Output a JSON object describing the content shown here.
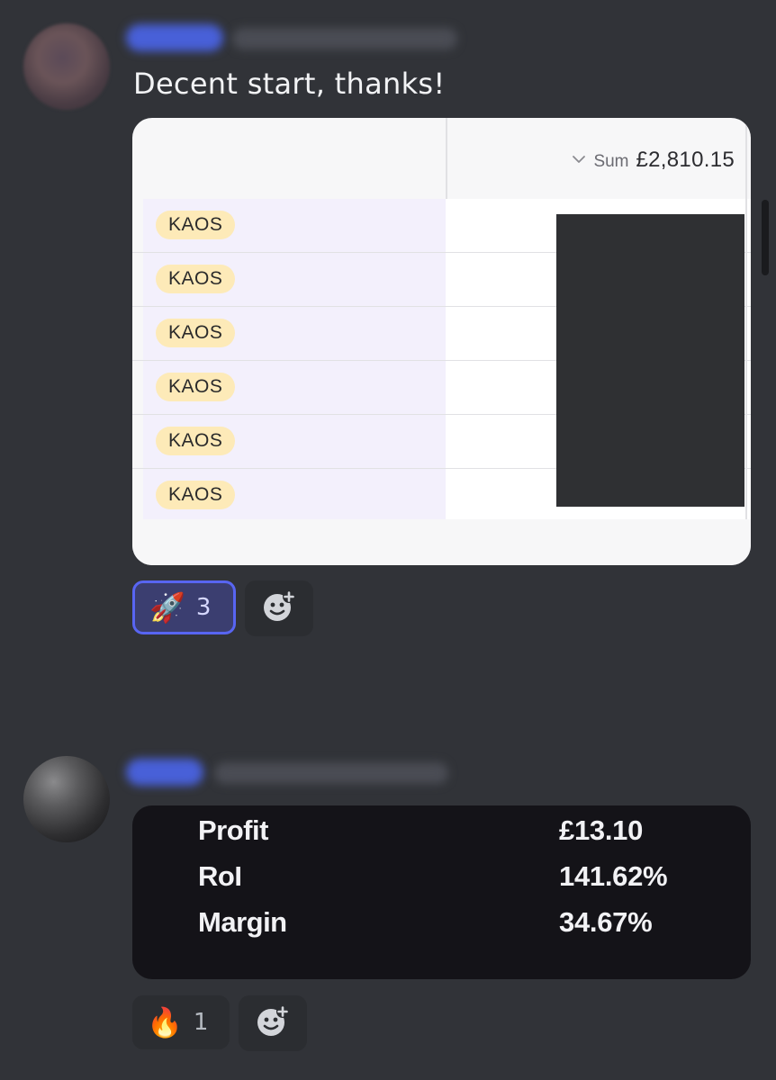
{
  "messages": [
    {
      "text": "Decent start, thanks!",
      "attachment": {
        "header": {
          "sum_label": "Sum",
          "sum_value": "£2,810.15"
        },
        "rows": [
          {
            "tag": "KAOS"
          },
          {
            "tag": "KAOS"
          },
          {
            "tag": "KAOS"
          },
          {
            "tag": "KAOS"
          },
          {
            "tag": "KAOS"
          },
          {
            "tag": "KAOS"
          }
        ]
      },
      "reactions": [
        {
          "emoji": "🚀",
          "count": "3",
          "active": true
        }
      ]
    },
    {
      "attachment": {
        "stats": [
          {
            "label": "Profit",
            "value": "£13.10"
          },
          {
            "label": "RoI",
            "value": "141.62%"
          },
          {
            "label": "Margin",
            "value": "34.67%"
          }
        ]
      },
      "reactions": [
        {
          "emoji": "🔥",
          "count": "1",
          "active": false
        }
      ]
    }
  ],
  "icons": {
    "add_reaction": "add-reaction-icon",
    "chevron": "chevron-down-icon"
  },
  "colors": {
    "background": "#313338",
    "active_reaction_border": "#5865f2",
    "tag_background": "#fdeab8"
  }
}
